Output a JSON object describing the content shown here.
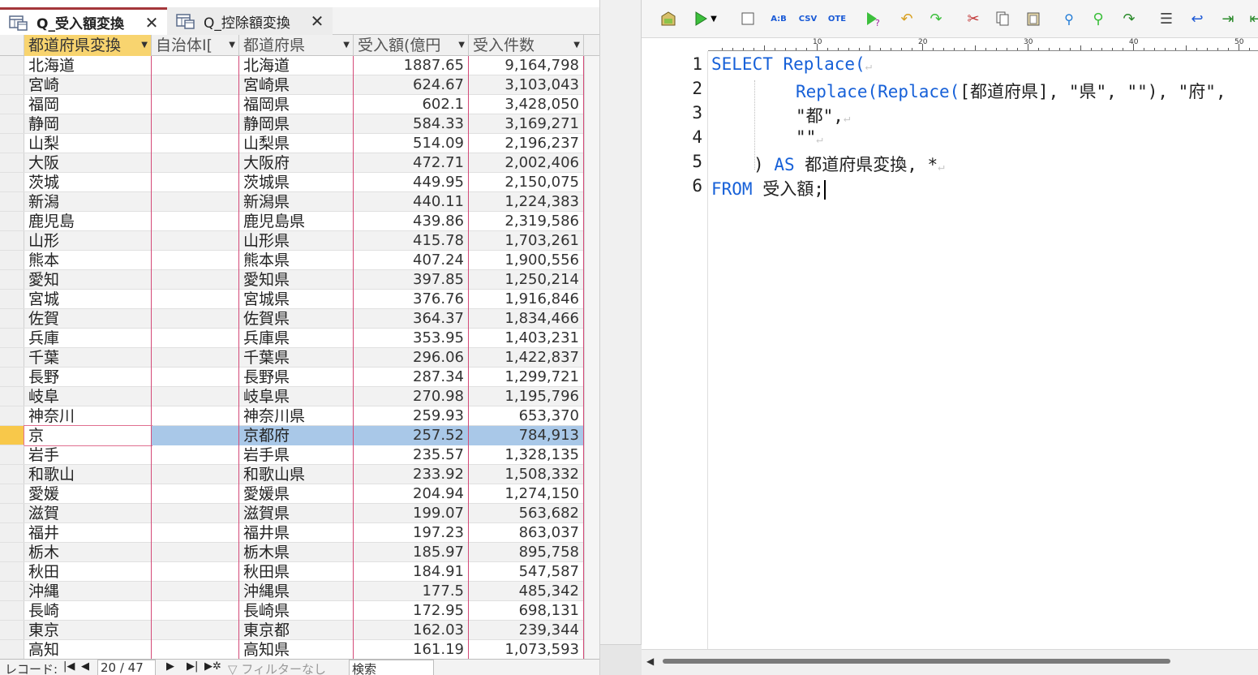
{
  "left": {
    "tabs": [
      {
        "label": "Q_受入額変換",
        "close": "✕"
      },
      {
        "label": "Q_控除額変換",
        "close": "✕"
      }
    ],
    "columns": [
      "都道府県変換",
      "自治体ID",
      "都道府県",
      "受入額(億円)",
      "受入件数"
    ],
    "column_visible_labels": [
      "都道府県変換",
      "自治体I[",
      "都道府県",
      "受入額(億円",
      "受入件数"
    ],
    "rows": [
      [
        "北海道",
        "",
        "北海道",
        "1887.65",
        "9,164,798"
      ],
      [
        "宮崎",
        "",
        "宮崎県",
        "624.67",
        "3,103,043"
      ],
      [
        "福岡",
        "",
        "福岡県",
        "602.1",
        "3,428,050"
      ],
      [
        "静岡",
        "",
        "静岡県",
        "584.33",
        "3,169,271"
      ],
      [
        "山梨",
        "",
        "山梨県",
        "514.09",
        "2,196,237"
      ],
      [
        "大阪",
        "",
        "大阪府",
        "472.71",
        "2,002,406"
      ],
      [
        "茨城",
        "",
        "茨城県",
        "449.95",
        "2,150,075"
      ],
      [
        "新潟",
        "",
        "新潟県",
        "440.11",
        "1,224,383"
      ],
      [
        "鹿児島",
        "",
        "鹿児島県",
        "439.86",
        "2,319,586"
      ],
      [
        "山形",
        "",
        "山形県",
        "415.78",
        "1,703,261"
      ],
      [
        "熊本",
        "",
        "熊本県",
        "407.24",
        "1,900,556"
      ],
      [
        "愛知",
        "",
        "愛知県",
        "397.85",
        "1,250,214"
      ],
      [
        "宮城",
        "",
        "宮城県",
        "376.76",
        "1,916,846"
      ],
      [
        "佐賀",
        "",
        "佐賀県",
        "364.37",
        "1,834,466"
      ],
      [
        "兵庫",
        "",
        "兵庫県",
        "353.95",
        "1,403,231"
      ],
      [
        "千葉",
        "",
        "千葉県",
        "296.06",
        "1,422,837"
      ],
      [
        "長野",
        "",
        "長野県",
        "287.34",
        "1,299,721"
      ],
      [
        "岐阜",
        "",
        "岐阜県",
        "270.98",
        "1,195,796"
      ],
      [
        "神奈川",
        "",
        "神奈川県",
        "259.93",
        "653,370"
      ],
      [
        "京",
        "",
        "京都府",
        "257.52",
        "784,913"
      ],
      [
        "岩手",
        "",
        "岩手県",
        "235.57",
        "1,328,135"
      ],
      [
        "和歌山",
        "",
        "和歌山県",
        "233.92",
        "1,508,332"
      ],
      [
        "愛媛",
        "",
        "愛媛県",
        "204.94",
        "1,274,150"
      ],
      [
        "滋賀",
        "",
        "滋賀県",
        "199.07",
        "563,682"
      ],
      [
        "福井",
        "",
        "福井県",
        "197.23",
        "863,037"
      ],
      [
        "栃木",
        "",
        "栃木県",
        "185.97",
        "895,758"
      ],
      [
        "秋田",
        "",
        "秋田県",
        "184.91",
        "547,587"
      ],
      [
        "沖縄",
        "",
        "沖縄県",
        "177.5",
        "485,342"
      ],
      [
        "長崎",
        "",
        "長崎県",
        "172.95",
        "698,131"
      ],
      [
        "東京",
        "",
        "東京都",
        "162.03",
        "239,344"
      ],
      [
        "高知",
        "",
        "高知県",
        "161.19",
        "1,073,593"
      ]
    ],
    "current_row_index": 19,
    "nav": {
      "record_label": "レコード:",
      "first": "|◀",
      "prev": "◀",
      "position": "20 / 47",
      "next": "▶",
      "last": "▶|",
      "new": "▶✲",
      "filter_label": "フィルターなし",
      "search_placeholder": "検索"
    }
  },
  "right": {
    "toolbar_icons": [
      "open-icon",
      "run-icon",
      "dropdown-icon",
      "stop-icon",
      "ab-icon",
      "csv-icon",
      "ote-icon",
      "help-run-icon",
      "undo-icon",
      "redo-icon",
      "cut-icon",
      "copy-icon",
      "paste-icon",
      "find-icon",
      "replace-icon",
      "goto-icon",
      "align-icon",
      "wrap-icon",
      "indent-icon"
    ],
    "toolbar_labels": {
      "ab": "A:B",
      "csv": "CSV",
      "ote": "OTE"
    },
    "ruler_labels": [
      "10",
      "20",
      "30",
      "40",
      "50"
    ],
    "line_numbers": [
      "1",
      "2",
      "3",
      "4",
      "5",
      "6"
    ],
    "code": {
      "l1_kw": "SELECT",
      "l1_fn": "Replace(",
      "l2_fn": "Replace(Replace(",
      "l2_rest": "[都道府県], \"県\", \"\"), \"府\",",
      "l3": "\"都\",",
      "l4": "\"\"",
      "l5_paren": ")",
      "l5_kw": "AS",
      "l5_rest": "都道府県変換, *",
      "l6_kw": "FROM",
      "l6_rest": "受入額;",
      "eol_mark": "↵"
    },
    "colors": {
      "keyword": "#1660d8",
      "text": "#222222"
    }
  }
}
